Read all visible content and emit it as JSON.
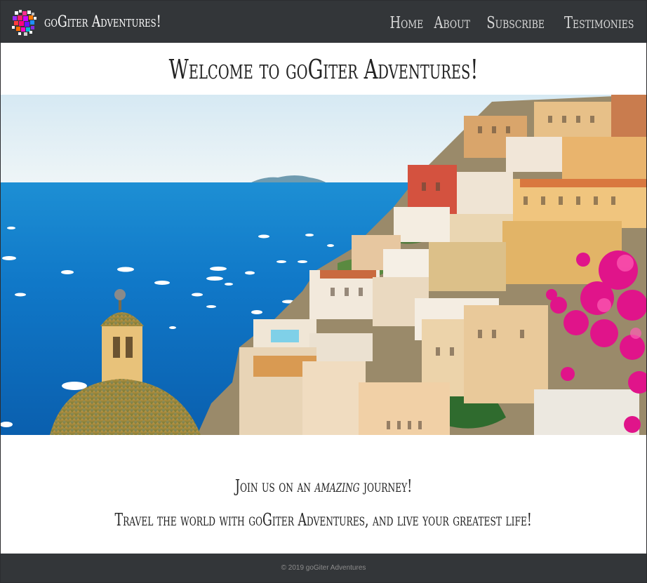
{
  "brand": {
    "name": "goGiter Adventures!"
  },
  "nav": {
    "items": [
      {
        "label": "Home"
      },
      {
        "label": "About"
      },
      {
        "label": "Subscribe"
      },
      {
        "label": "Testimonies"
      }
    ]
  },
  "main": {
    "heading": "Welcome to goGiter Adventures!",
    "tagline": {
      "before": "Join us on an ",
      "emphasis": "amazing",
      "after": " journey!"
    },
    "subline": "Travel the world with goGiter Adventures, and live your greatest life!"
  },
  "footer": {
    "copyright": "© 2019 goGiter Adventures"
  },
  "colors": {
    "navbar": "#333639",
    "footer": "#333639",
    "text": "#222222",
    "nav_text": "#d9d9d9"
  },
  "icons": {
    "logo": "pixel-mosaic-logo-icon"
  }
}
